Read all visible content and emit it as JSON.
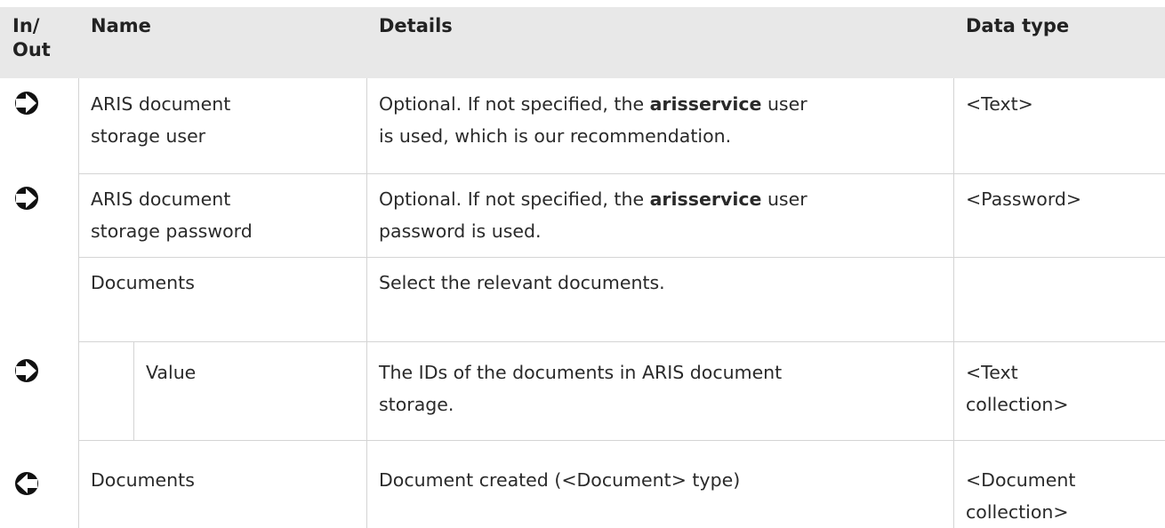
{
  "header": {
    "inout": "In/ Out",
    "inout_line1": "In/",
    "inout_line2": "Out",
    "name": "Name",
    "details": "Details",
    "datatype": "Data type"
  },
  "rows": [
    {
      "direction": "in",
      "icon": "arrow-right-icon",
      "name_line1": "ARIS document",
      "name_line2": "storage user",
      "details_pre": "Optional. If not specified, the ",
      "details_bold": "arisservice",
      "details_post": " user",
      "details_line2": "is used, which is our recommendation.",
      "datatype_line1": "<Text>",
      "datatype_line2": ""
    },
    {
      "direction": "in",
      "icon": "arrow-right-icon",
      "name_line1": "ARIS document",
      "name_line2": "storage password",
      "details_pre": "Optional. If not specified, the ",
      "details_bold": "arisservice",
      "details_post": " user",
      "details_line2": "password is used.",
      "datatype_line1": "<Password>",
      "datatype_line2": ""
    },
    {
      "direction": "",
      "icon": "",
      "name_line1": "Documents",
      "details_line1": "Select the relevant documents.",
      "datatype_line1": ""
    },
    {
      "direction": "in",
      "icon": "arrow-right-icon",
      "name_line1": "Value",
      "details_line1": "The IDs of the documents in ARIS document",
      "details_line2": "storage.",
      "datatype_line1": "<Text",
      "datatype_line2": "collection>"
    },
    {
      "direction": "out",
      "icon": "arrow-left-icon",
      "name_line1": "Documents",
      "details_line1": "Document created (<Document> type)",
      "datatype_line1": "<Document",
      "datatype_line2": "collection>"
    }
  ]
}
